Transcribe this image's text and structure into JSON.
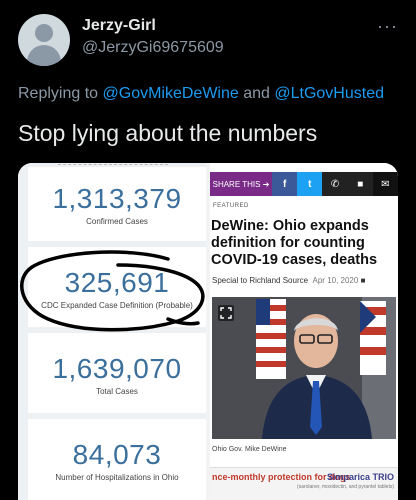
{
  "author": {
    "display_name": "Jerzy-Girl",
    "handle": "@JerzyGi69675609"
  },
  "more_icon": "more-horizontal-icon",
  "reply": {
    "prefix": "Replying to ",
    "mention1": "@GovMikeDeWine",
    "joiner": " and ",
    "mention2": "@LtGovHusted"
  },
  "tweet_text": "Stop lying about the numbers",
  "media": {
    "stats": [
      {
        "value": "1,313,379",
        "label": "Confirmed Cases"
      },
      {
        "value": "325,691",
        "label": "CDC Expanded Case Definition (Probable)"
      },
      {
        "value": "1,639,070",
        "label": "Total Cases"
      },
      {
        "value": "84,073",
        "label": "Number of Hospitalizations in Ohio"
      }
    ],
    "article": {
      "share_label": "SHARE THIS ➔",
      "share_icons": [
        "f",
        "t",
        "✆",
        "■",
        "✉"
      ],
      "featured": "FEATURED",
      "headline": "DeWine: Ohio expands definition for counting COVID-19 cases, deaths",
      "byline": "Special to Richland Source",
      "date": "Apr 10, 2020",
      "caption": "Ohio Gov. Mike DeWine",
      "ad_left": "nce-monthly protection for dogs",
      "ad_brand": "Simparica TRIO",
      "ad_sub": "(sarolaner, moxidectin, and pyrantel tablets)"
    },
    "colors": {
      "stat_number": "#3b6f9c",
      "share_purple": "#7a2a87",
      "mention_blue": "#1d9bf0"
    }
  }
}
